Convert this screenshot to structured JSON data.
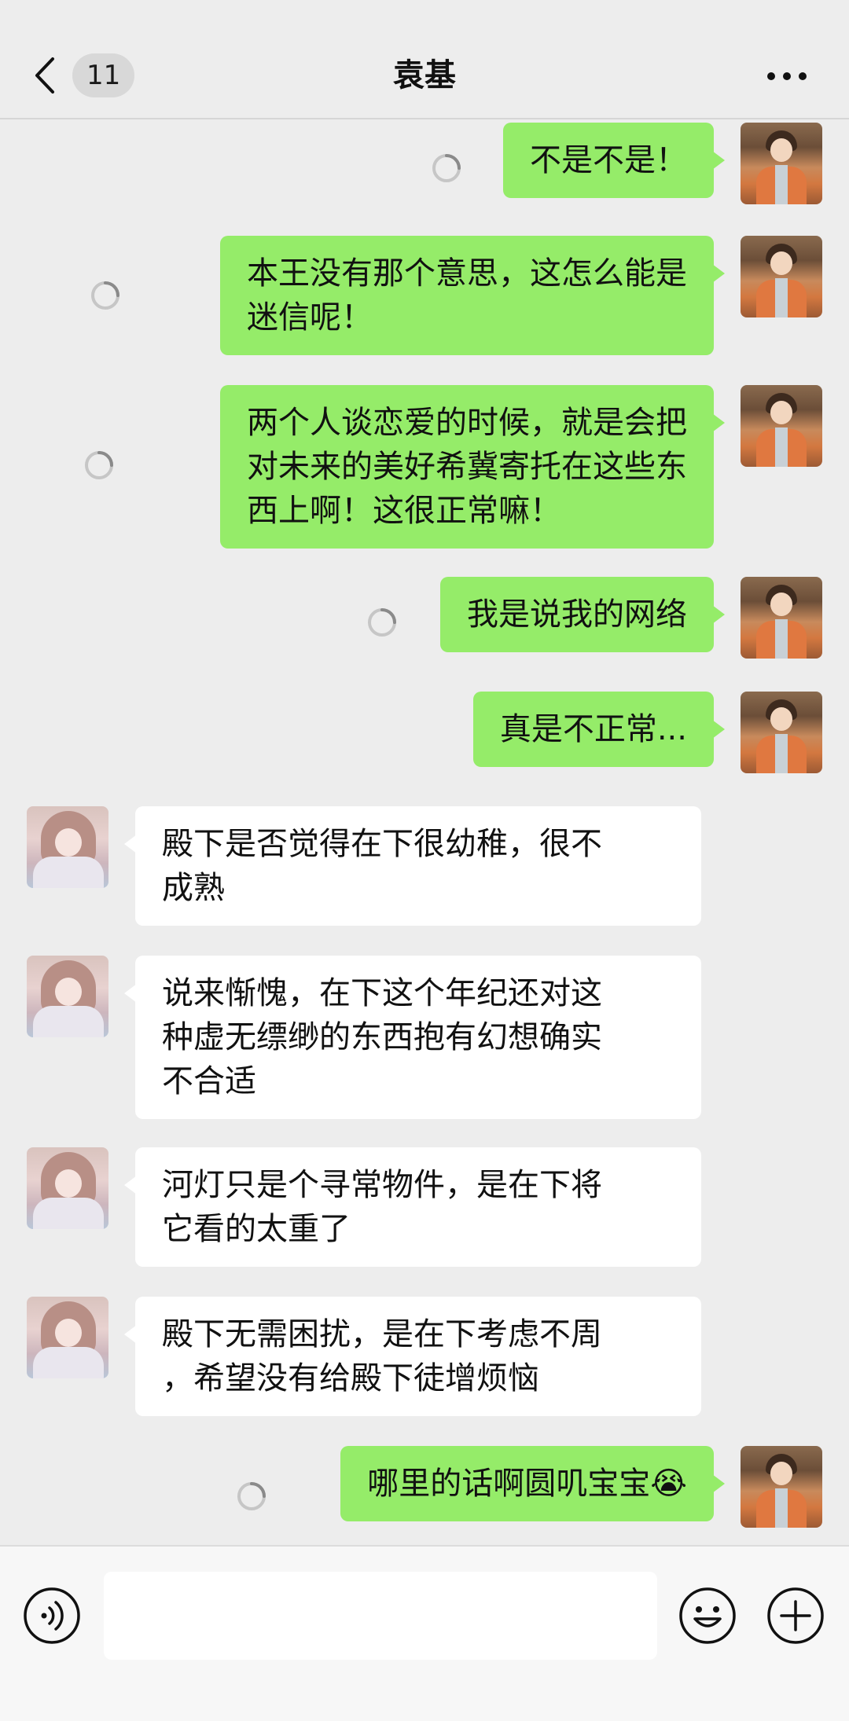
{
  "header": {
    "back_icon": "chevron-left-icon",
    "unread_count": "11",
    "title": "袁基",
    "more_icon": "more-dots-icon"
  },
  "messages": [
    {
      "side": "out",
      "text": "不是不是！",
      "status": "sending"
    },
    {
      "side": "out",
      "text": "本王没有那个意思，这怎么能是\n迷信呢！",
      "status": "sending"
    },
    {
      "side": "out",
      "text": "两个人谈恋爱的时候，就是会把\n对未来的美好希冀寄托在这些东\n西上啊！这很正常嘛！",
      "status": "sending"
    },
    {
      "side": "out",
      "text": "我是说我的网络",
      "status": "sending"
    },
    {
      "side": "out",
      "text": "真是不正常...",
      "status": "sent"
    },
    {
      "side": "in",
      "text": "殿下是否觉得在下很幼稚，很不\n成熟"
    },
    {
      "side": "in",
      "text": "说来惭愧，在下这个年纪还对这\n种虚无缥缈的东西抱有幻想确实\n不合适"
    },
    {
      "side": "in",
      "text": "河灯只是个寻常物件，是在下将\n它看的太重了"
    },
    {
      "side": "in",
      "text": "殿下无需困扰，是在下考虑不周\n，希望没有给殿下徒增烦恼"
    },
    {
      "side": "out",
      "text": "哪里的话啊圆叽宝宝😭",
      "status": "sending"
    }
  ],
  "input_bar": {
    "voice_icon": "voice-icon",
    "input_value": "",
    "emoji_icon": "emoji-icon",
    "plus_icon": "plus-icon"
  },
  "colors": {
    "background": "#ededed",
    "outgoing_bubble": "#95ec69",
    "incoming_bubble": "#ffffff"
  }
}
